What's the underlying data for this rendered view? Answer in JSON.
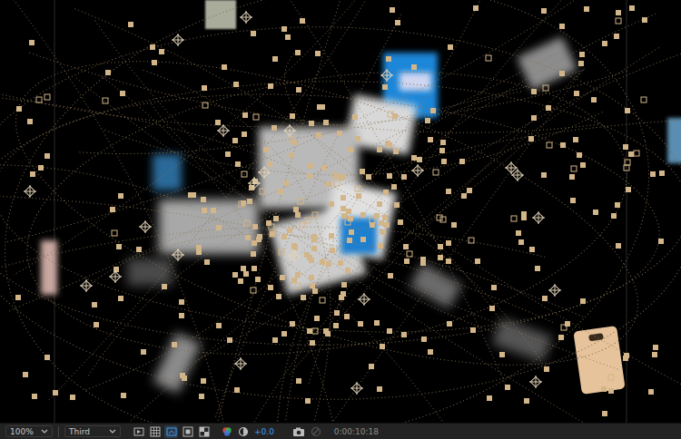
{
  "toolbar": {
    "zoom": "100%",
    "resolution": "Third",
    "toggles": [
      {
        "kind": "previews",
        "on": false
      },
      {
        "kind": "grid",
        "on": false
      },
      {
        "kind": "mask",
        "on": true
      },
      {
        "kind": "region",
        "on": false
      },
      {
        "kind": "transparency",
        "on": false
      }
    ],
    "exposure": "+0.0",
    "timecode": "0:00:10:18"
  }
}
